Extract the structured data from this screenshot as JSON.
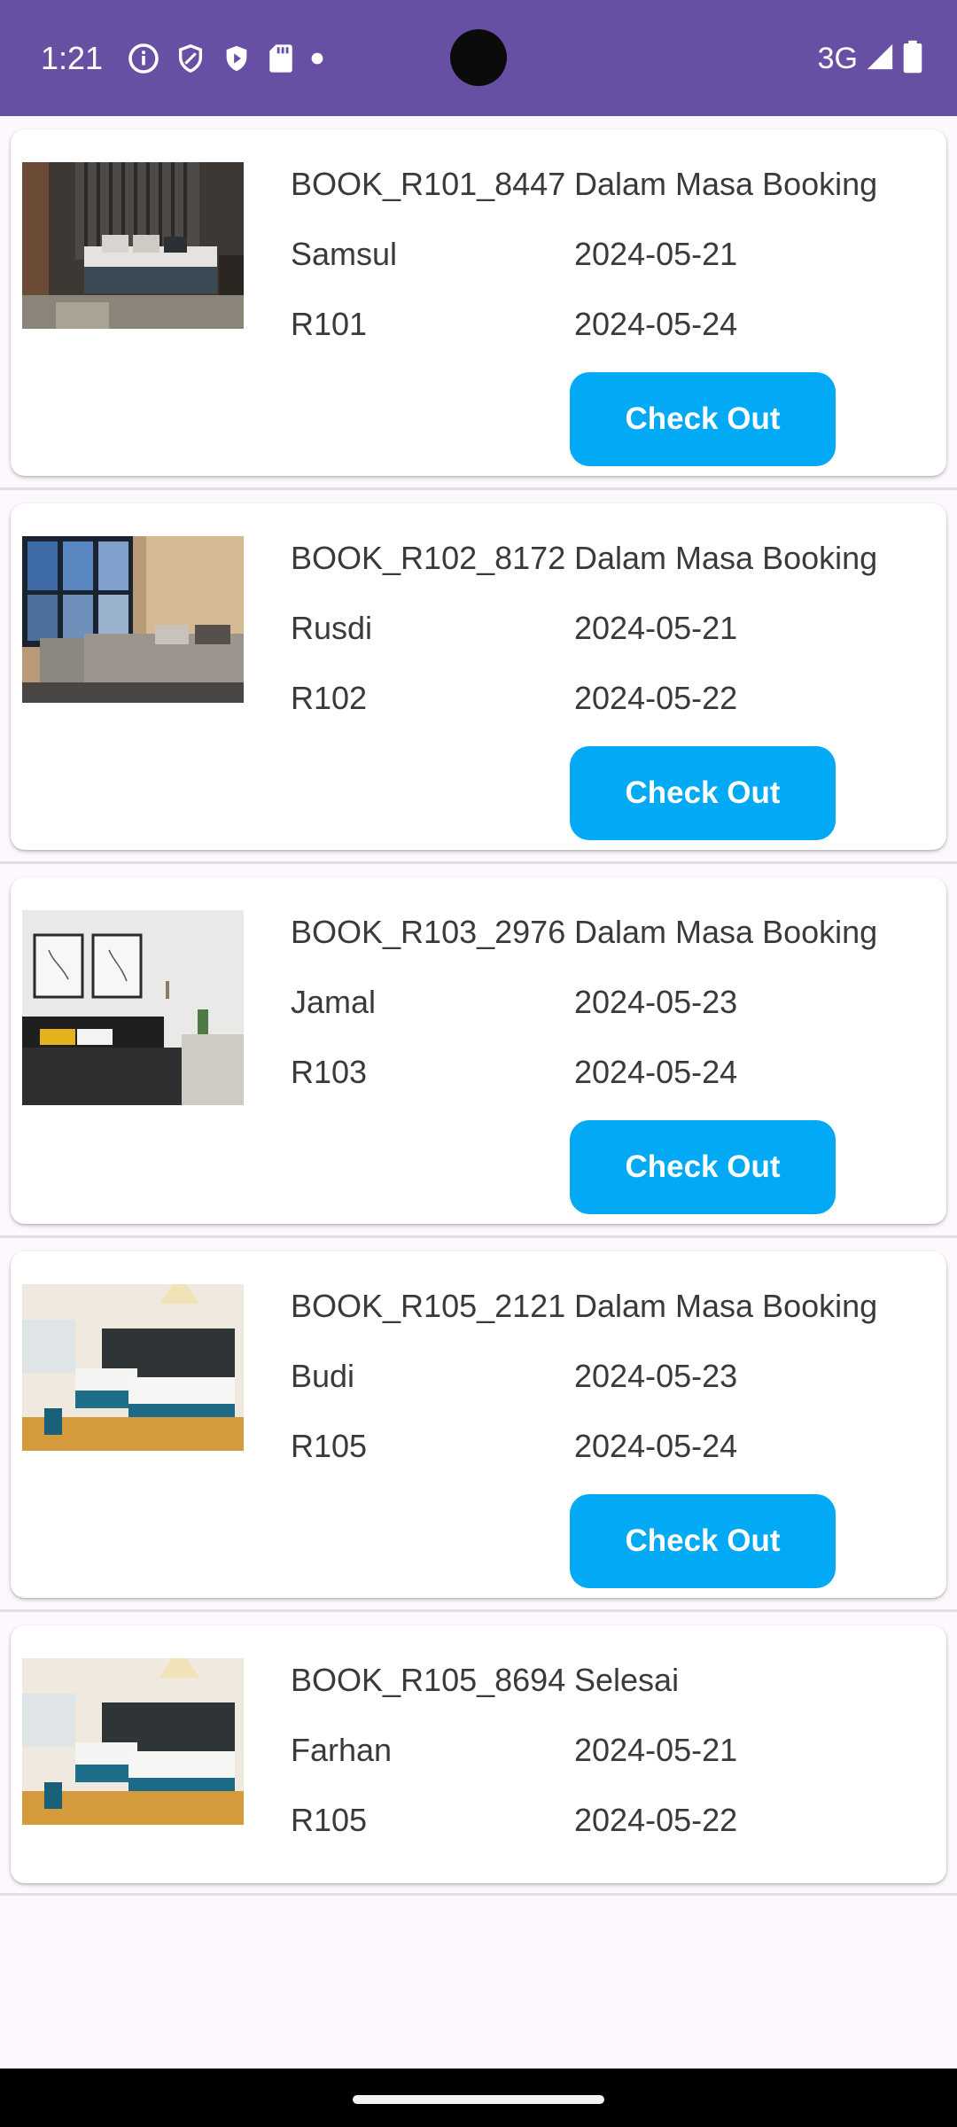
{
  "status_bar": {
    "time": "1:21",
    "network": "3G",
    "background": "#6750a4",
    "icons_left": [
      "info-icon",
      "shield-icon",
      "play-shield-icon",
      "sd-card-icon",
      "dot-icon"
    ],
    "icons_right": [
      "signal-icon",
      "battery-icon"
    ]
  },
  "bookings": [
    {
      "booking_id": "BOOK_R101_8447",
      "status": "Dalam Masa Booking",
      "guest": "Samsul",
      "check_in": "2024-05-21",
      "room": "R101",
      "check_out": "2024-05-24",
      "button": "Check Out"
    },
    {
      "booking_id": "BOOK_R102_8172",
      "status": "Dalam Masa Booking",
      "guest": "Rusdi",
      "check_in": "2024-05-21",
      "room": "R102",
      "check_out": "2024-05-22",
      "button": "Check Out"
    },
    {
      "booking_id": "BOOK_R103_2976",
      "status": "Dalam Masa Booking",
      "guest": "Jamal",
      "check_in": "2024-05-23",
      "room": "R103",
      "check_out": "2024-05-24",
      "button": "Check Out"
    },
    {
      "booking_id": "BOOK_R105_2121",
      "status": "Dalam Masa Booking",
      "guest": "Budi",
      "check_in": "2024-05-23",
      "room": "R105",
      "check_out": "2024-05-24",
      "button": "Check Out"
    },
    {
      "booking_id": "BOOK_R105_8694",
      "status": "Selesai",
      "guest": "Farhan",
      "check_in": "2024-05-21",
      "room": "R105",
      "check_out": "2024-05-22"
    }
  ],
  "colors": {
    "accent_button": "#02a9f4",
    "text": "#3a3a3a",
    "page_background": "#fdf8fd"
  }
}
